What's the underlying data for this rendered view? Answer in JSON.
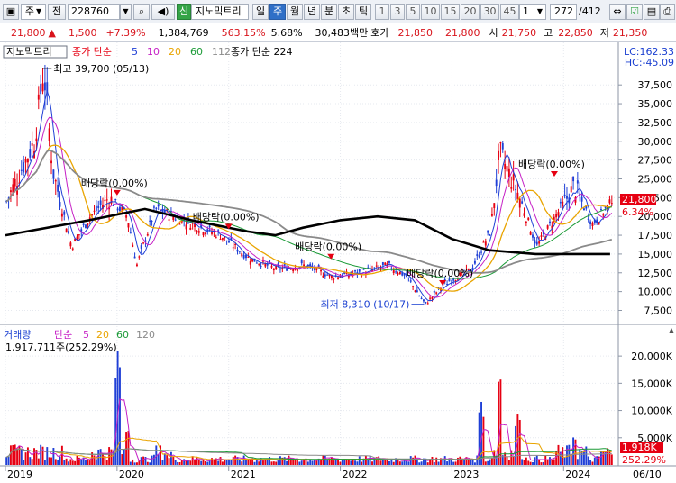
{
  "toolbar": {
    "market": "주",
    "type": "전",
    "code": "228760",
    "new_badge": "신",
    "stock_name": "지노믹트리",
    "periods": [
      "일",
      "주",
      "월",
      "년",
      "분",
      "초",
      "틱"
    ],
    "active_period": "주",
    "minutes": [
      "1",
      "3",
      "5",
      "10",
      "15",
      "20",
      "30",
      "45",
      "60"
    ],
    "unit": "1",
    "count": "272",
    "total": "/412"
  },
  "quote": {
    "price": "21,800",
    "change_arrow": "▲",
    "change": "1,500",
    "change_pct": "+7.39%",
    "volume": "1,384,769",
    "vol_ratio": "563.15%",
    "turnover": "5.68%",
    "amount": "30,483백만",
    "ask_label": "호가",
    "ask1": "21,850",
    "ask2": "21,800",
    "open_label": "시",
    "open": "21,750",
    "high_label": "고",
    "high": "22,850",
    "low_label": "저",
    "low": "21,350"
  },
  "price_panel": {
    "title": "지노믹트리",
    "ma_label": "종가 단순",
    "ma_periods": [
      "5",
      "10",
      "20",
      "60",
      "112"
    ],
    "ma_long_label": "종가 단순 224",
    "lc": "LC:162.33",
    "hc": "HC:-45.09",
    "high_marker": "최고 39,700 (05/13)",
    "low_marker": "최저 8,310 (10/17)",
    "current_price": "21,800",
    "current_pct": "6.34%",
    "y_ticks": [
      "37,500",
      "35,000",
      "32,500",
      "30,000",
      "27,500",
      "25,000",
      "22,500",
      "20,000",
      "17,500",
      "15,000",
      "12,500",
      "10,000",
      "7,500"
    ],
    "dividends": [
      "배당락(0.00%)",
      "배당락(0.00%)",
      "배당락(0.00%)",
      "배당락(0.00%)",
      "배당락(0.00%)"
    ]
  },
  "volume_panel": {
    "title": "거래량",
    "ma_label": "단순",
    "ma_periods": [
      "5",
      "20",
      "60",
      "120"
    ],
    "last_volume": "1,917,711주(252.29%)",
    "y_ticks": [
      "20,000K",
      "15,000K",
      "10,000K",
      "5,000K"
    ],
    "current_volume": "1,918K",
    "current_pct": "252.29%"
  },
  "x_axis": {
    "years": [
      "2019",
      "2020",
      "2021",
      "2022",
      "2023",
      "2024"
    ],
    "last_date": "06/10"
  },
  "colors": {
    "up": "#e60012",
    "down": "#1f3fd6",
    "ma5": "#1f3fd6",
    "ma10": "#c51fc5",
    "ma20": "#e9a400",
    "ma60": "#1a9a36",
    "ma112": "#8a8a8a",
    "ma224": "#000000"
  },
  "chart_data": {
    "type": "candlestick",
    "interval": "weekly",
    "price_range": [
      6000,
      41000
    ],
    "volume_range": [
      0,
      23000000
    ],
    "anchors": [
      {
        "date": "2019-01",
        "close": 22000
      },
      {
        "date": "2019-04",
        "close": 30000
      },
      {
        "date": "2019-05",
        "close": 39700
      },
      {
        "date": "2019-06",
        "close": 26000
      },
      {
        "date": "2019-08",
        "close": 16000
      },
      {
        "date": "2019-10",
        "close": 20000
      },
      {
        "date": "2019-12",
        "close": 22500
      },
      {
        "date": "2020-02",
        "close": 20000
      },
      {
        "date": "2020-03",
        "close": 13500
      },
      {
        "date": "2020-05",
        "close": 21000
      },
      {
        "date": "2020-09",
        "close": 19000
      },
      {
        "date": "2020-12",
        "close": 17500
      },
      {
        "date": "2021-03",
        "close": 14500
      },
      {
        "date": "2021-06",
        "close": 13000
      },
      {
        "date": "2021-09",
        "close": 13500
      },
      {
        "date": "2021-12",
        "close": 12000
      },
      {
        "date": "2022-03",
        "close": 12500
      },
      {
        "date": "2022-06",
        "close": 13500
      },
      {
        "date": "2022-08",
        "close": 12000
      },
      {
        "date": "2022-10",
        "close": 8310
      },
      {
        "date": "2022-12",
        "close": 11000
      },
      {
        "date": "2023-03",
        "close": 13000
      },
      {
        "date": "2023-05",
        "close": 18000
      },
      {
        "date": "2023-06",
        "close": 28500
      },
      {
        "date": "2023-08",
        "close": 23000
      },
      {
        "date": "2023-10",
        "close": 16000
      },
      {
        "date": "2023-12",
        "close": 20000
      },
      {
        "date": "2024-02",
        "close": 24000
      },
      {
        "date": "2024-04",
        "close": 19000
      },
      {
        "date": "2024-06",
        "close": 21800
      }
    ],
    "ma224_path": [
      {
        "date": "2019-01",
        "value": 17500
      },
      {
        "date": "2019-10",
        "value": 19500
      },
      {
        "date": "2020-04",
        "value": 21000
      },
      {
        "date": "2020-09",
        "value": 19500
      },
      {
        "date": "2021-03",
        "value": 18000
      },
      {
        "date": "2021-06",
        "value": 17500
      },
      {
        "date": "2021-09",
        "value": 18500
      },
      {
        "date": "2022-01",
        "value": 19500
      },
      {
        "date": "2022-05",
        "value": 20000
      },
      {
        "date": "2022-09",
        "value": 19500
      },
      {
        "date": "2023-01",
        "value": 17000
      },
      {
        "date": "2023-05",
        "value": 15500
      },
      {
        "date": "2023-10",
        "value": 15000
      },
      {
        "date": "2024-06",
        "value": 15000
      }
    ],
    "volume_spikes": [
      {
        "date": "2020-01",
        "volume": 22000000
      },
      {
        "date": "2020-02",
        "volume": 7000000
      },
      {
        "date": "2023-04",
        "volume": 12000000
      },
      {
        "date": "2023-06",
        "volume": 17500000
      },
      {
        "date": "2023-08",
        "volume": 10000000
      },
      {
        "date": "2024-02",
        "volume": 5500000
      }
    ],
    "last_volume": 1917711
  }
}
